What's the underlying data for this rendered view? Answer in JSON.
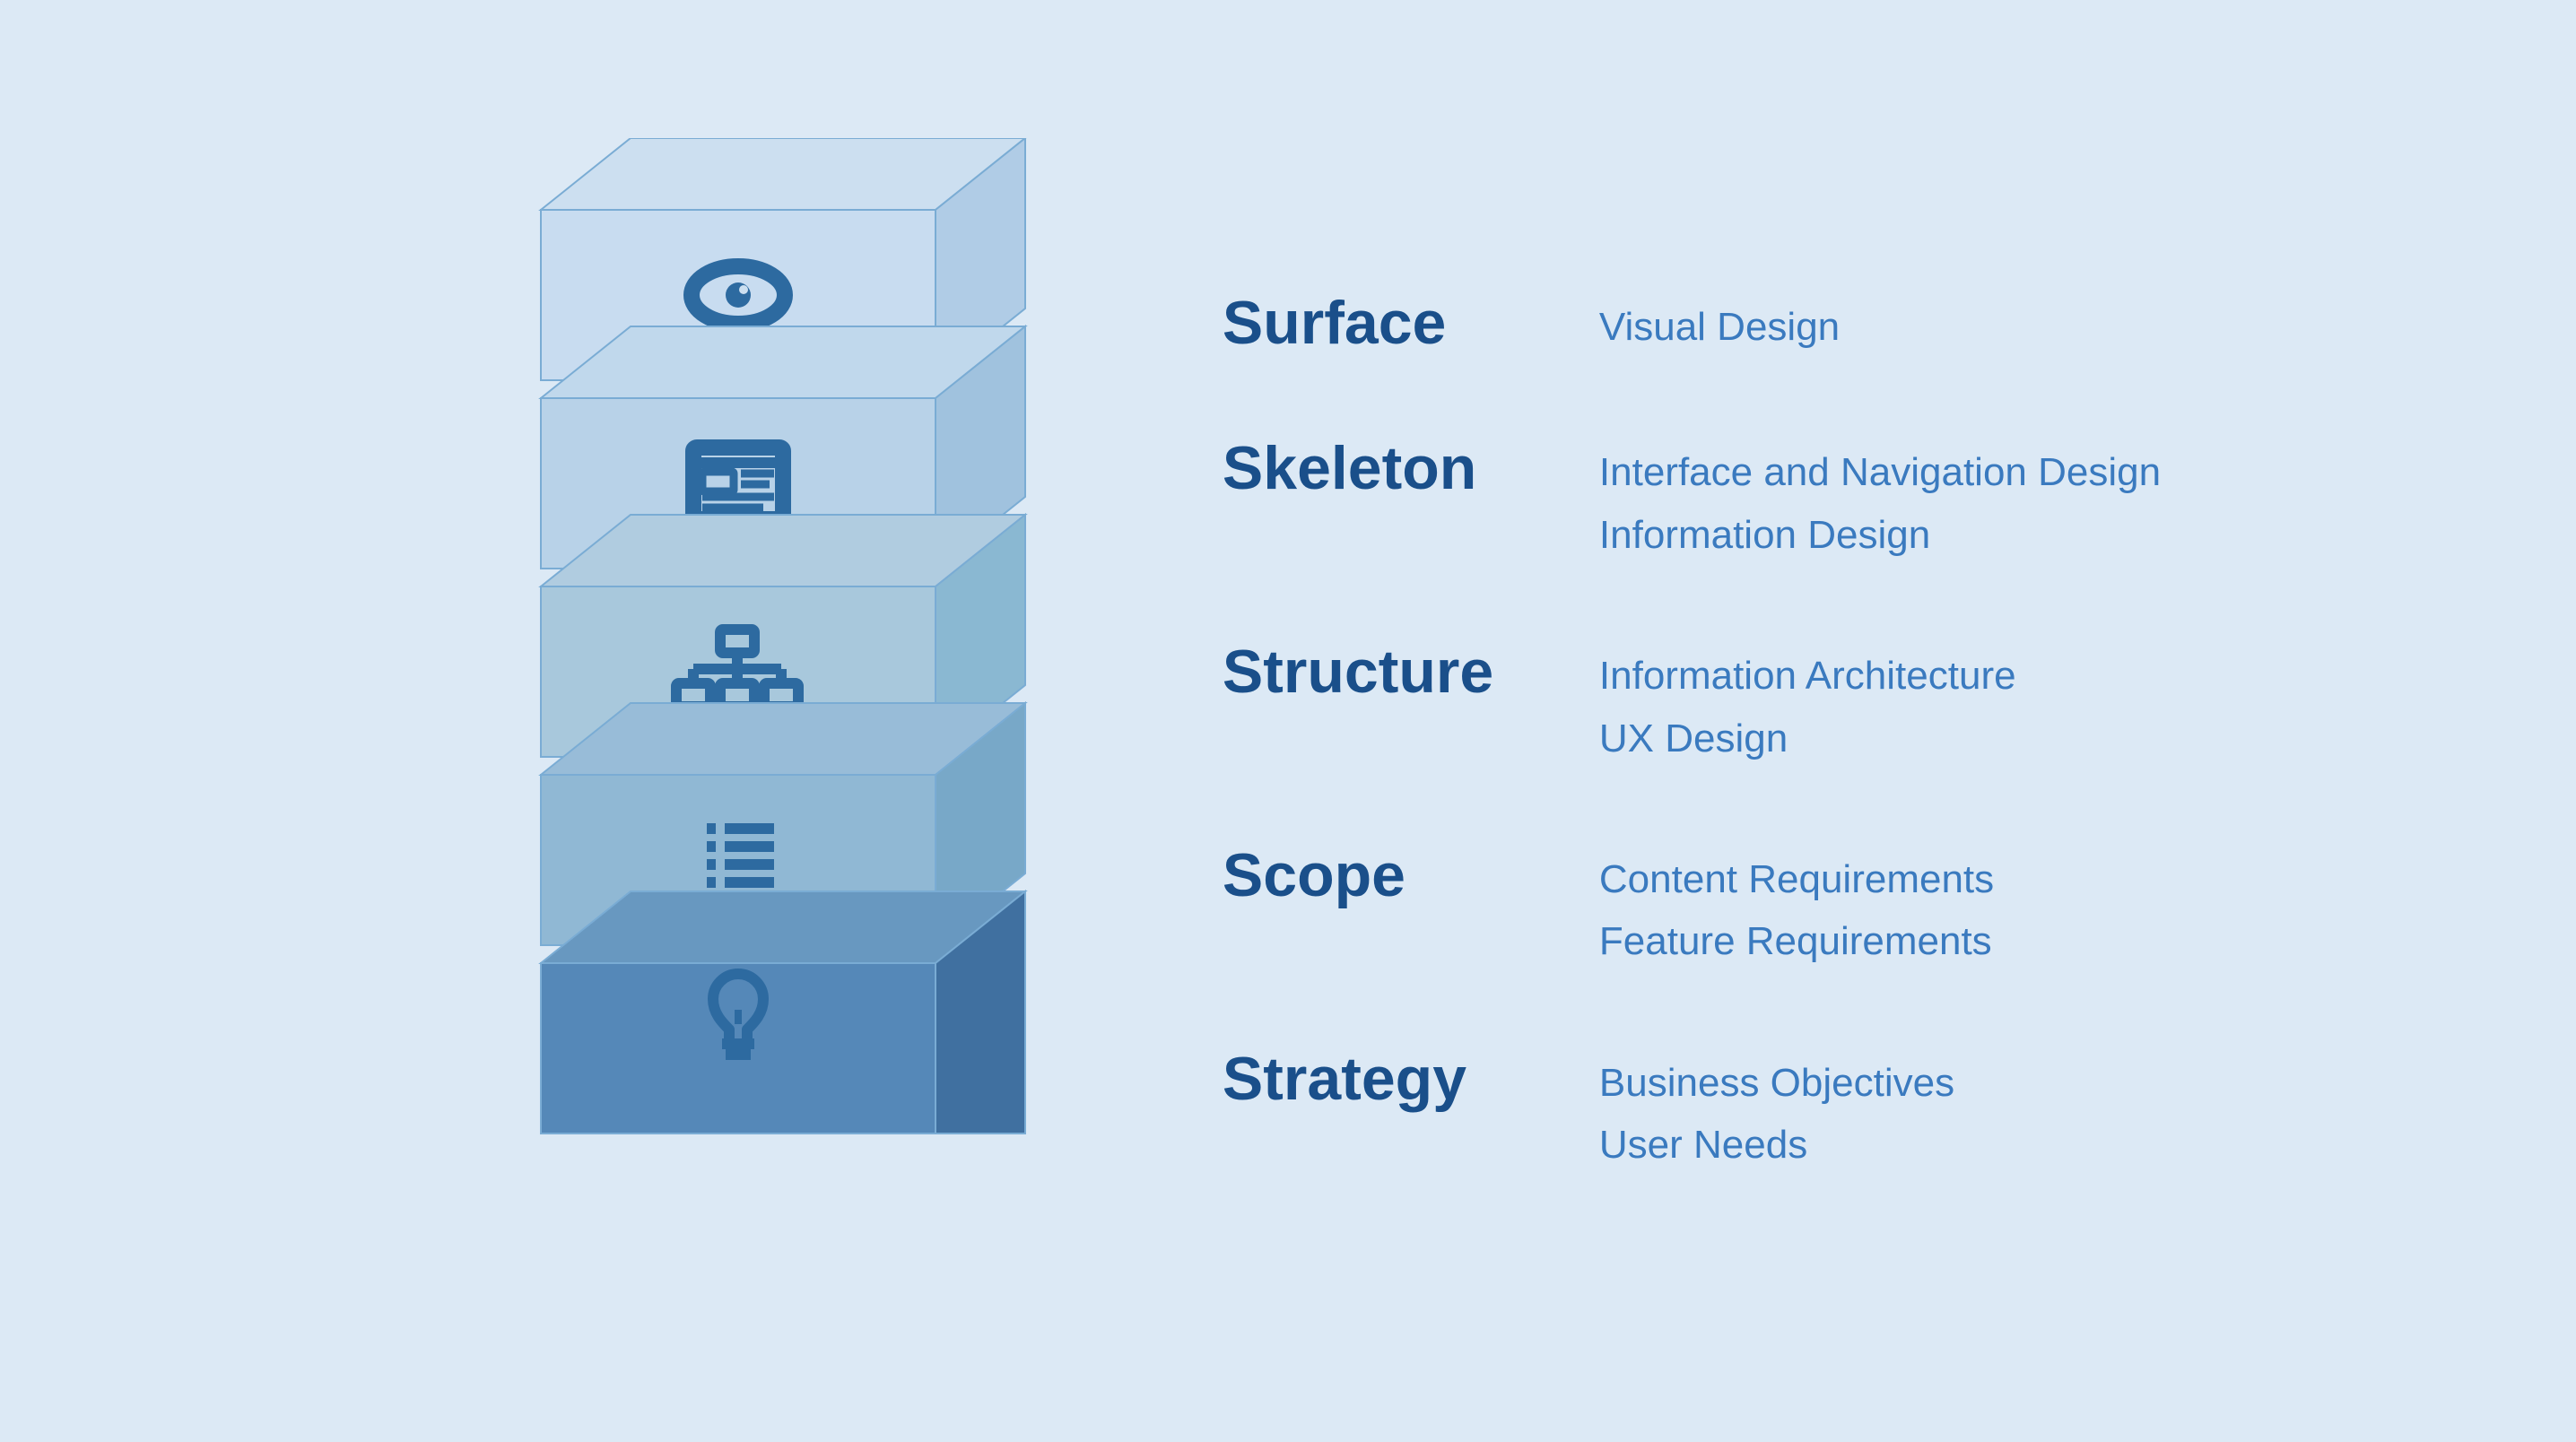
{
  "layers": [
    {
      "id": "surface",
      "title": "Surface",
      "description": [
        "Visual Design"
      ],
      "icon": "eye"
    },
    {
      "id": "skeleton",
      "title": "Skeleton",
      "description": [
        "Interface and Navigation Design",
        "Information Design"
      ],
      "icon": "wireframe"
    },
    {
      "id": "structure",
      "title": "Structure",
      "description": [
        "Information Architecture",
        "UX Design"
      ],
      "icon": "sitemap"
    },
    {
      "id": "scope",
      "title": "Scope",
      "description": [
        "Content Requirements",
        "Feature Requirements"
      ],
      "icon": "list"
    },
    {
      "id": "strategy",
      "title": "Strategy",
      "description": [
        "Business Objectives",
        "User Needs"
      ],
      "icon": "lightbulb"
    }
  ],
  "colors": {
    "bg": "#dce9f5",
    "layer_fills": [
      "#c8dcf0",
      "#b5cfea",
      "#9dbde0",
      "#7aacd4",
      "#4a7fb5"
    ],
    "layer_stroke": "#7aacd4",
    "icon_color": "#2d6aa0",
    "title_color": "#1a4f8a",
    "desc_color": "#3a7abf"
  }
}
